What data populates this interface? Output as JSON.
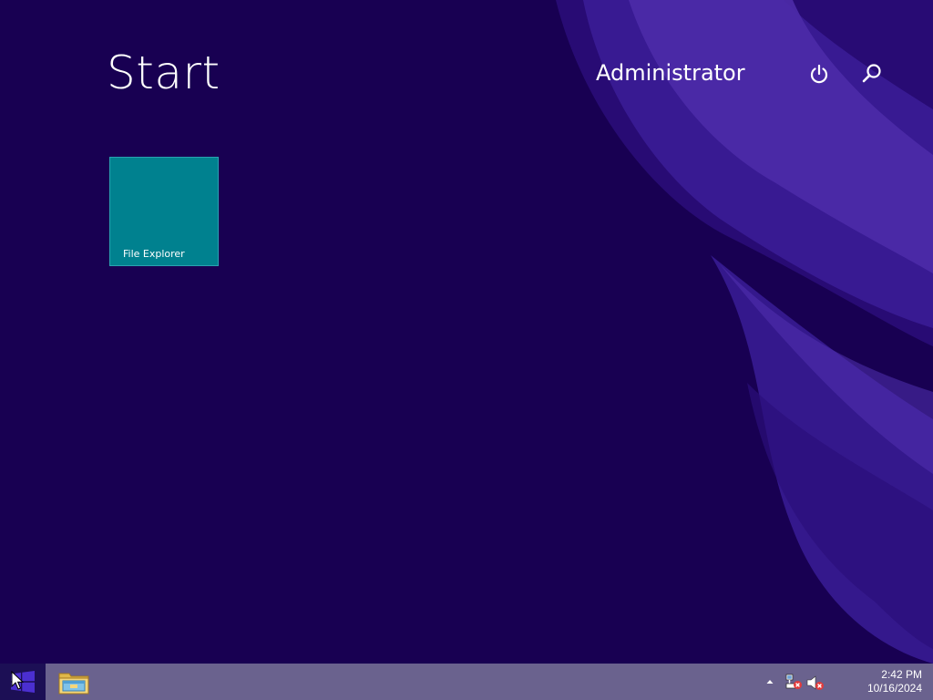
{
  "screen": {
    "title": "Start",
    "user_name": "Administrator",
    "power_icon": "power-icon",
    "search_icon": "search-icon"
  },
  "tiles": [
    {
      "label": "File Explorer",
      "color": "#00818f"
    }
  ],
  "taskbar": {
    "start_icon": "windows-logo-icon",
    "pinned": [
      {
        "name": "File Explorer",
        "icon": "file-explorer-icon"
      }
    ],
    "tray_icons": [
      "show-hidden-icons-chevron",
      "network-disconnected-icon",
      "volume-muted-icon"
    ],
    "clock": {
      "time": "2:42 PM",
      "date": "10/16/2024"
    }
  },
  "colors": {
    "background": "#180052",
    "accent_swoosh": "#4d2ba8",
    "taskbar": "#6a628e",
    "tile": "#00818f"
  }
}
